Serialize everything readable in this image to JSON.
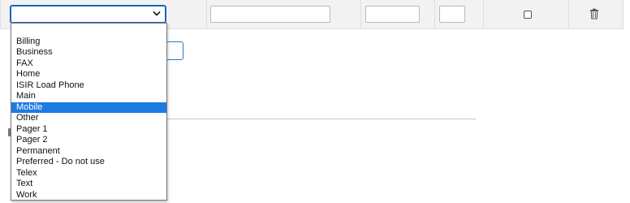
{
  "row": {
    "type_select": {
      "value": ""
    },
    "inputs": [
      {
        "name": "phone-number-input",
        "value": ""
      },
      {
        "name": "extension-input",
        "value": ""
      },
      {
        "name": "country-code-input",
        "value": ""
      }
    ],
    "checkbox_checked": false
  },
  "dropdown": {
    "selected_index": 7,
    "options": [
      "",
      "Billing",
      "Business",
      "FAX",
      "Home",
      "ISIR Load Phone",
      "Main",
      "Mobile",
      "Other",
      "Pager 1",
      "Pager 2",
      "Permanent",
      "Preferred - Do not use",
      "Telex",
      "Text",
      "Work"
    ]
  },
  "colors": {
    "focus_blue": "#1565c0",
    "selected_option_bg": "#1e7be3",
    "row_bg": "#f2f2f2"
  },
  "icons": {
    "dropdown": "chevron-down-icon",
    "delete": "trash-icon"
  }
}
